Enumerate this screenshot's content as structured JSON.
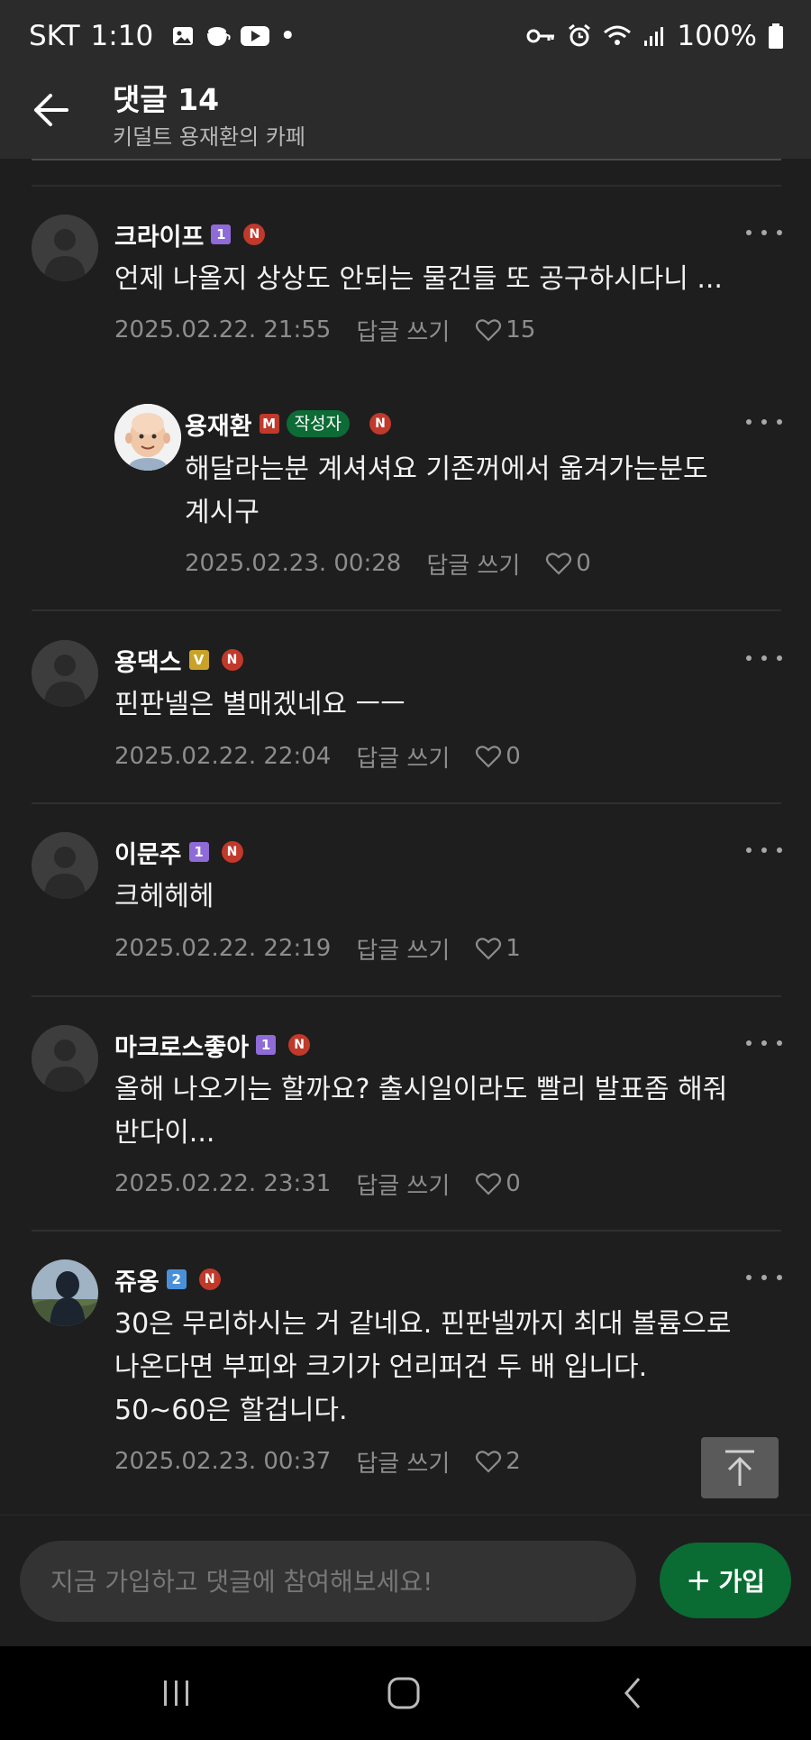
{
  "status_bar": {
    "carrier": "SKT",
    "time": "1:10",
    "dot": "•",
    "battery": "100%"
  },
  "header": {
    "title": "댓글 14",
    "subtitle": "키덜트 용재환의 카페"
  },
  "comments": [
    {
      "author": "크라이프",
      "level": "1",
      "level_color": "#8e6bd6",
      "text": "언제 나올지 상상도 안되는 물건들 또 공구하시다니 ...",
      "date": "2025.02.22. 21:55",
      "reply_label": "답글 쓰기",
      "likes": "15",
      "avatar": "default"
    },
    {
      "author": "용재환",
      "level": "M",
      "level_color": "#c0392b",
      "writer_badge": "작성자",
      "text": "해달라는분 계셔셔요 기존꺼에서 옮겨가는분도\n계시구",
      "date": "2025.02.23. 00:28",
      "reply_label": "답글 쓰기",
      "likes": "0",
      "avatar": "bald-man-illustration",
      "is_reply": true
    },
    {
      "author": "용댁스",
      "level": "V",
      "level_color": "#c9a227",
      "text": "핀판넬은 별매겠네요 ㅡㅡ",
      "date": "2025.02.22. 22:04",
      "reply_label": "답글 쓰기",
      "likes": "0",
      "avatar": "default"
    },
    {
      "author": "이문주",
      "level": "1",
      "level_color": "#8e6bd6",
      "text": "크헤헤헤",
      "date": "2025.02.22. 22:19",
      "reply_label": "답글 쓰기",
      "likes": "1",
      "avatar": "default"
    },
    {
      "author": "마크로스좋아",
      "level": "1",
      "level_color": "#8e6bd6",
      "text": "올해 나오기는 할까요? 출시일이라도 빨리 발표좀 해줘\n반다이...",
      "date": "2025.02.22. 23:31",
      "reply_label": "답글 쓰기",
      "likes": "0",
      "avatar": "default"
    },
    {
      "author": "쥬옹",
      "level": "2",
      "level_color": "#4a90d9",
      "text": "30은 무리하시는 거 같네요. 핀판넬까지 최대 볼륨으로\n나온다면 부피와 크기가 언리퍼건 두 배 입니다.\n50~60은 할겁니다.",
      "date": "2025.02.23. 00:37",
      "reply_label": "답글 쓰기",
      "likes": "2",
      "avatar": "hooded-figure-photo"
    }
  ],
  "n_badge": "N",
  "input": {
    "placeholder": "지금 가입하고 댓글에 참여해보세요!"
  },
  "join_button": {
    "label": "가입",
    "plus": "+"
  },
  "colors": {
    "background": "#1e1e1e",
    "header": "#2b2b2b",
    "accent_green": "#0a6b33",
    "n_badge_red": "#c0392b"
  }
}
